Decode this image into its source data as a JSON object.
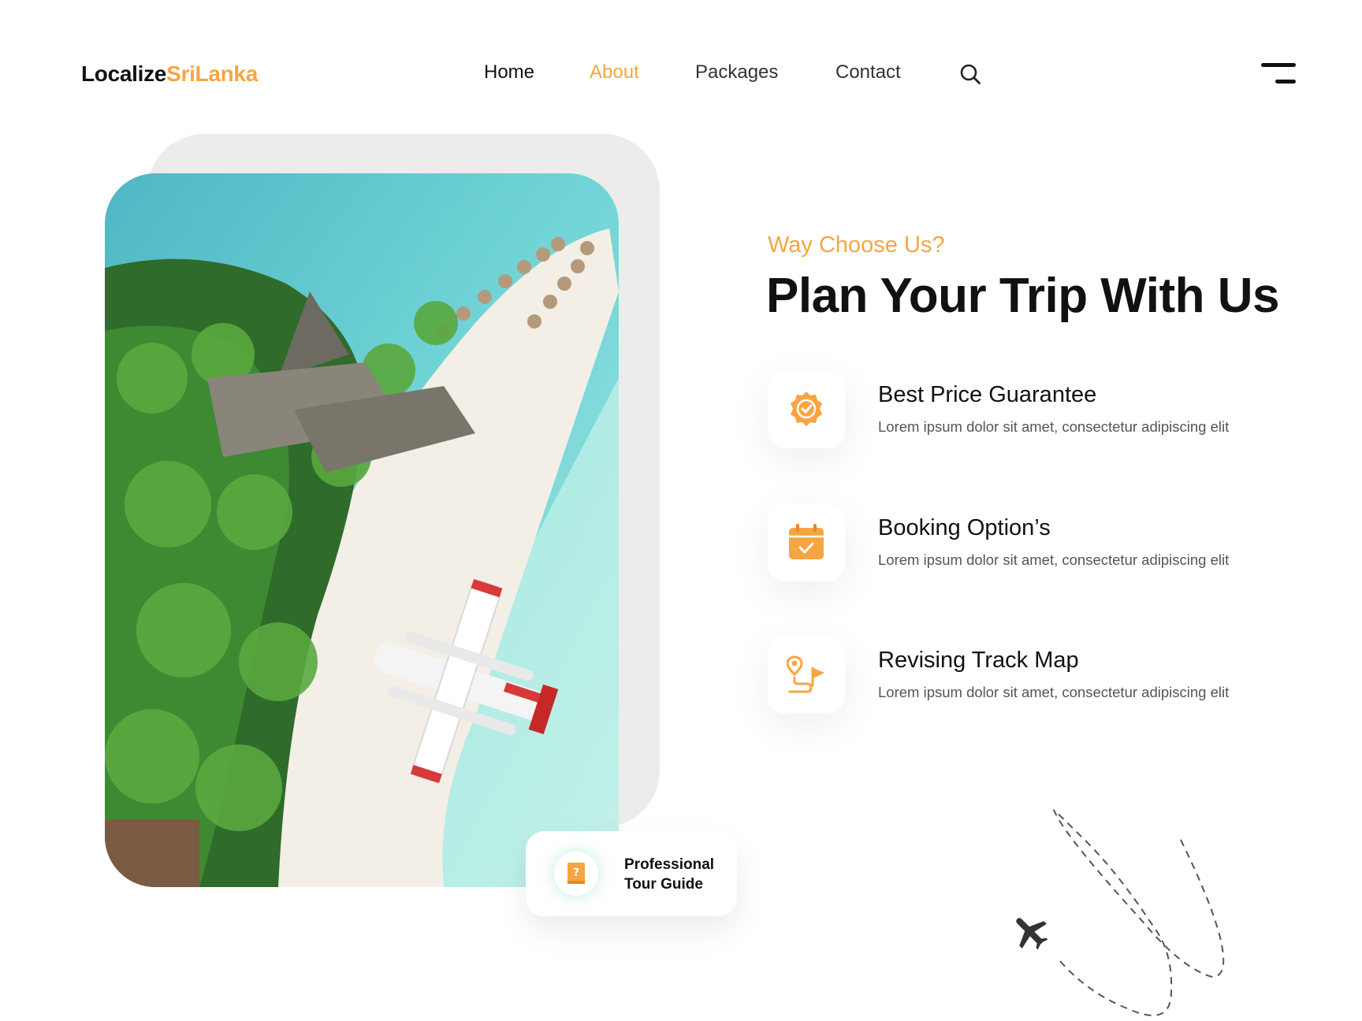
{
  "brand": {
    "part1": "Localize",
    "part2": "SriLanka"
  },
  "nav": {
    "items": [
      {
        "label": "Home"
      },
      {
        "label": "About"
      },
      {
        "label": "Packages"
      },
      {
        "label": "Contact"
      }
    ],
    "active": "About",
    "search_icon": "search-icon",
    "menu_icon": "hamburger-menu-icon"
  },
  "section": {
    "eyebrow": "Way Choose Us?",
    "headline": "Plan Your Trip With Us"
  },
  "features": [
    {
      "title": "Best Price Guarantee",
      "description": "Lorem ipsum dolor sit amet, consectetur adipiscing elit",
      "icon": "badge-check-icon"
    },
    {
      "title": "Booking Option’s",
      "description": "Lorem ipsum dolor sit amet, consectetur adipiscing elit",
      "icon": "calendar-check-icon"
    },
    {
      "title": "Revising Track Map",
      "description": "Lorem ipsum dolor sit amet, consectetur adipiscing elit",
      "icon": "route-map-icon"
    }
  ],
  "guide_card": {
    "line1": "Professional",
    "line2": "Tour Guide",
    "icon": "guide-book-icon"
  },
  "colors": {
    "accent": "#F7A541",
    "text": "#111111",
    "muted": "#555555",
    "card_back": "#ECECEC"
  }
}
